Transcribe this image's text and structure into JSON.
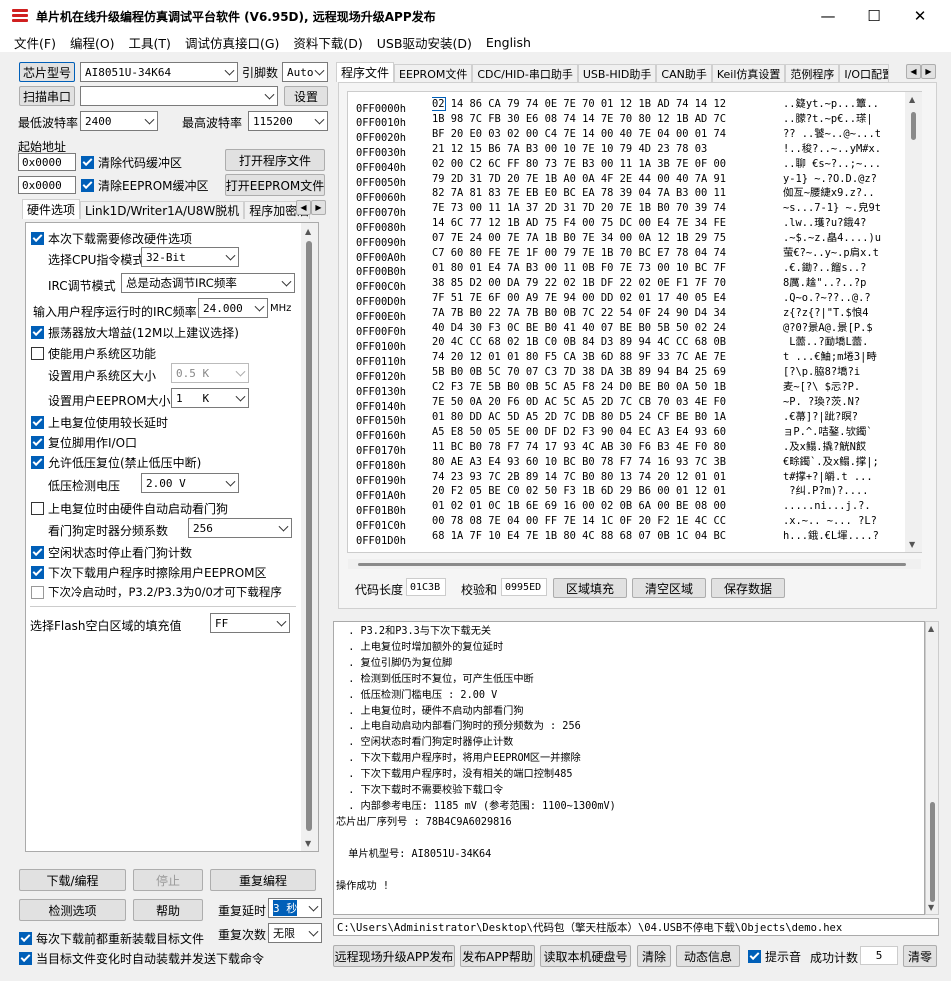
{
  "window": {
    "title": "单片机在线升级编程仿真调试平台软件 (V6.95D), 远程现场升级APP发布",
    "minimize": "—",
    "maximize": "☐",
    "close": "✕"
  },
  "menu": [
    "文件(F)",
    "编程(O)",
    "工具(T)",
    "调试仿真接口(G)",
    "资料下载(D)",
    "USB驱动安装(D)",
    "English"
  ],
  "left": {
    "chip_button": "芯片型号",
    "chip_value": "AI8051U-34K64",
    "pins_label": "引脚数",
    "pins_value": "Auto",
    "scan_button": "扫描串口",
    "port_value": "",
    "settings_button": "设置",
    "min_baud_label": "最低波特率",
    "min_baud_value": "2400",
    "max_baud_label": "最高波特率",
    "max_baud_value": "115200",
    "start_addr_label": "起始地址",
    "addr1": "0x0000",
    "clear_code": "清除代码缓冲区",
    "open_program": "打开程序文件",
    "addr2": "0x0000",
    "clear_eeprom": "清除EEPROM缓冲区",
    "open_eeprom": "打开EEPROM文件",
    "tabs": [
      "硬件选项",
      "Link1D/Writer1A/U8W脱机",
      "程序加密后"
    ],
    "opt_modify_hw": "本次下载需要修改硬件选项",
    "cpu_mode_label": "选择CPU指令模式",
    "cpu_mode_value": "32-Bit",
    "irc_label": "IRC调节模式",
    "irc_value": "总是动态调节IRC频率",
    "irc_freq_label": "输入用户程序运行时的IRC频率",
    "irc_freq_value": "24.000",
    "irc_freq_unit": "MHz",
    "opt_osc_gain": "振荡器放大增益(12M以上建议选择)",
    "opt_user_sys": "使能用户系统区功能",
    "user_sys_size_label": "设置用户系统区大小",
    "user_sys_size_value": "0.5 K",
    "user_eeprom_label": "设置用户EEPROM大小",
    "user_eeprom_value": "1   K",
    "opt_long_delay": "上电复位使用较长延时",
    "opt_reset_io": "复位脚用作I/O口",
    "opt_lvr": "允许低压复位(禁止低压中断)",
    "lvd_label": "低压检测电压",
    "lvd_value": "2.00 V",
    "opt_wdt_auto": "上电复位时由硬件自动启动看门狗",
    "wdt_div_label": "看门狗定时器分频系数",
    "wdt_div_value": "256",
    "opt_wdt_idle": "空闲状态时停止看门狗计数",
    "opt_erase_eeprom": "下次下载用户程序时擦除用户EEPROM区",
    "opt_p32": "下次冷启动时，P3.2/P3.3为0/0才可下载程序",
    "flash_fill_label": "选择Flash空白区域的填充值",
    "flash_fill_value": "FF",
    "download_button": "下载/编程",
    "stop_button": "停止",
    "reprogram_button": "重复编程",
    "detect_button": "检测选项",
    "help_button": "帮助",
    "repeat_delay_label": "重复延时",
    "repeat_delay_value": "3 秒",
    "repeat_count_label": "重复次数",
    "repeat_count_value": "无限",
    "opt_reload": "每次下载前都重新装载目标文件",
    "opt_auto_send": "当目标文件变化时自动装载并发送下载命令"
  },
  "right": {
    "tabs": [
      "程序文件",
      "EEPROM文件",
      "CDC/HID-串口助手",
      "USB-HID助手",
      "CAN助手",
      "Keil仿真设置",
      "范例程序",
      "I/O口配置"
    ],
    "hex_rows": [
      {
        "addr": "0FF0000h",
        "bytes": "02 14 86 CA 79 74 0E 7E 70 01 12 1B AD 74 14 12",
        "ascii": "..籎yt.~p...簟.."
      },
      {
        "addr": "0FF0010h",
        "bytes": "1B 98 7C FB 30 E6 08 74 14 7E 70 80 12 1B AD 7C",
        "ascii": "..朦?t.~p€..瑹|"
      },
      {
        "addr": "0FF0020h",
        "bytes": "BF 20 E0 03 02 00 C4 7E 14 00 40 7E 04 00 01 74",
        "ascii": "?? ..饕~..@~...t"
      },
      {
        "addr": "0FF0030h",
        "bytes": "21 12 15 B6 7A B3 00 10 7E 10 79 4D 23 78 03",
        "ascii": "!..稄?..~..yM#x."
      },
      {
        "addr": "0FF0040h",
        "bytes": "02 00 C2 6C FF 80 73 7E B3 00 11 1A 3B 7E 0F 00",
        "ascii": "..聊 €s~?..;~..."
      },
      {
        "addr": "0FF0050h",
        "bytes": "79 2D 31 7D 20 7E 1B A0 0A 4F 2E 44 00 40 7A 91",
        "ascii": "y-1} ~.?O.D.@z?"
      },
      {
        "addr": "0FF0060h",
        "bytes": "82 7A 81 83 7E EB E0 BC EA 78 39 04 7A B3 00 11",
        "ascii": "侞亙~腰緁x9.z?.."
      },
      {
        "addr": "0FF0070h",
        "bytes": "7E 73 00 11 1A 37 2D 31 7D 20 7E 1B B0 70 39 74",
        "ascii": "~s...7-1} ~.皃9t"
      },
      {
        "addr": "0FF0080h",
        "bytes": "14 6C 77 12 1B AD 75 F4 00 75 DC 00 E4 7E 34 FE",
        "ascii": ".lw..瓁?u?鋨4?"
      },
      {
        "addr": "0FF0090h",
        "bytes": "07 7E 24 00 7E 7A 1B B0 7E 34 00 0A 12 1B 29 75",
        "ascii": ".~$.~z.皛4....)u"
      },
      {
        "addr": "0FF00A0h",
        "bytes": "C7 60 80 FE 7E 1F 00 79 7E 1B 70 BC E7 78 04 74",
        "ascii": "萤€?~..y~.p肩x.t"
      },
      {
        "addr": "0FF00B0h",
        "bytes": "01 80 01 E4 7A B3 00 11 0B F0 7E 73 00 10 BC 7F",
        "ascii": ".€.鋤?..餾s..?"
      },
      {
        "addr": "0FF00C0h",
        "bytes": "38 85 D2 00 DA 79 22 02 1B DF 22 02 0E F1 7F 70",
        "ascii": "8厲.趛\"..?..?p"
      },
      {
        "addr": "0FF00D0h",
        "bytes": "7F 51 7E 6F 00 A9 7E 94 00 DD 02 01 17 40 05 E4",
        "ascii": ".Q~o.?~??..@.?"
      },
      {
        "addr": "0FF00E0h",
        "bytes": "7A 7B B0 22 7A 7B B0 0B 7C 22 54 0F 24 90 D4 34",
        "ascii": "z{?z{?|\"T.$悢4"
      },
      {
        "addr": "0FF00F0h",
        "bytes": "40 D4 30 F3 0C BE B0 41 40 07 BE B0 5B 50 02 24",
        "ascii": "@?0?景A@.景[P.$"
      },
      {
        "addr": "0FF0100h",
        "bytes": "20 4C CC 68 02 1B C0 0B 84 D3 89 94 4C CC 68 0B",
        "ascii": " L蘦..?勔墧L蘦."
      },
      {
        "addr": "0FF0110h",
        "bytes": "74 20 12 01 01 80 F5 CA 3B 6D 88 9F 33 7C AE 7E",
        "ascii": "t ...€鮋;m埢3|畤"
      },
      {
        "addr": "0FF0120h",
        "bytes": "5B B0 0B 5C 70 07 C3 7D 38 DA 3B 89 94 B4 25 69",
        "ascii": "[?\\p.脇8?墧?i"
      },
      {
        "addr": "0FF0130h",
        "bytes": "C2 F3 7E 5B B0 0B 5C A5 F8 24 D0 BE B0 0A 50 1B",
        "ascii": "麦~[?\\ $忈?P."
      },
      {
        "addr": "0FF0140h",
        "bytes": "7E 50 0A 20 F6 0D AC 5C A5 2D 7C CB 70 03 4E F0",
        "ascii": "~P. ?瑍?茨.N?"
      },
      {
        "addr": "0FF0150h",
        "bytes": "01 80 DD AC 5D A5 2D 7C DB 80 D5 24 CF BE B0 1A",
        "ascii": ".€菷]?|跐?瞑?"
      },
      {
        "addr": "0FF0160h",
        "bytes": "A5 E8 50 05 5E 00 DF D2 F3 90 04 EC A3 E4 93 60",
        "ascii": "ョP.^.咭鏊.欤鐲`"
      },
      {
        "addr": "0FF0170h",
        "bytes": "11 BC B0 78 F7 74 17 93 4C AB 30 F6 B3 4E F0 80",
        "ascii": ".及x鳎.撬?觥N餀"
      },
      {
        "addr": "0FF0180h",
        "bytes": "80 AE A3 E4 93 60 10 BC B0 78 F7 74 16 93 7C 3B",
        "ascii": "€畭鐲`.及x鳎.撑|;"
      },
      {
        "addr": "0FF0190h",
        "bytes": "74 23 93 7C 2B 89 14 7C B0 80 13 74 20 12 01 01",
        "ascii": "t#撑+?|皭.t ..."
      },
      {
        "addr": "0FF01A0h",
        "bytes": "20 F2 05 BE C0 02 50 F3 1B 6D 29 B6 00 01 12 01",
        "ascii": " ?纠.P?m)?...."
      },
      {
        "addr": "0FF01B0h",
        "bytes": "01 02 01 0C 1B 6E 69 16 00 02 0B 6A 00 BE 08 00",
        "ascii": ".....ni...j.?."
      },
      {
        "addr": "0FF01C0h",
        "bytes": "00 78 08 7E 04 00 FF 7E 14 1C 0F 20 F2 1E 4C CC",
        "ascii": ".x.~.. ~... ?L?"
      },
      {
        "addr": "0FF01D0h",
        "bytes": "68 1A 7F 10 E4 7E 1B 80 4C 88 68 07 0B 1C 04 BC",
        "ascii": "h...鋨.€L堚....?"
      }
    ],
    "code_len_label": "代码长度",
    "code_len_value": "01C3B",
    "checksum_label": "校验和",
    "checksum_value": "0995ED",
    "fill_button": "区域填充",
    "clear_area_button": "清空区域",
    "save_button": "保存数据",
    "log_lines": [
      "  . P3.2和P3.3与下次下载无关",
      "  . 上电复位时增加额外的复位延时",
      "  . 复位引脚仍为复位脚",
      "  . 检测到低压时不复位，可产生低压中断",
      "  . 低压检测门槛电压 : 2.00 V",
      "  . 上电复位时，硬件不启动内部看门狗",
      "  . 上电自动启动内部看门狗时的预分频数为 : 256",
      "  . 空闲状态时看门狗定时器停止计数",
      "  . 下次下载用户程序时，将用户EEPROM区一并擦除",
      "  . 下次下载用户程序时，没有相关的端口控制485",
      "  . 下次下载时不需要校验下载口令",
      "  . 内部参考电压: 1185 mV (参考范围: 1100~1300mV)",
      "芯片出厂序列号 : 78B4C9A6029816",
      "",
      "  单片机型号: AI8051U-34K64",
      "",
      "操作成功 !"
    ],
    "file_path": "C:\\Users\\Administrator\\Desktop\\代码包（擎天柱版本）\\04.USB不停电下载\\Objects\\demo.hex",
    "remote_button": "远程现场升级APP发布",
    "publish_help_button": "发布APP帮助",
    "read_disk_button": "读取本机硬盘号",
    "clear_button": "清除",
    "dynamic_button": "动态信息",
    "beep_label": "提示音",
    "success_label": "成功计数",
    "success_value": "5",
    "reset_count_button": "清零"
  },
  "colors": {
    "accent": "#005fb8",
    "panel": "#f0f0f0",
    "title_icon": "#d02020"
  }
}
